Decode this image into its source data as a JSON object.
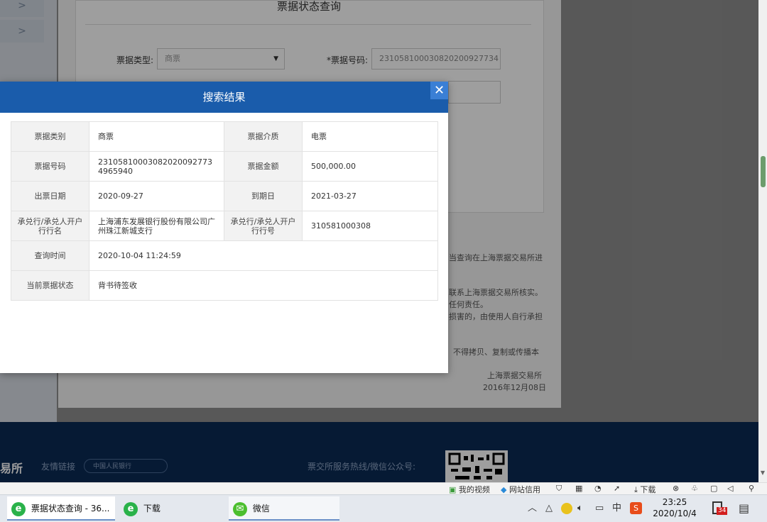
{
  "background": {
    "nav_arrows": [
      ">",
      ">"
    ],
    "page_title": "票据状态查询",
    "form": {
      "bill_type_label": "票据类型:",
      "bill_type_value": "商票",
      "bill_no_label": "*票据号码:",
      "bill_no_value": "231058100030820200927734"
    },
    "notice_lines": [
      "当查询在上海票据交易所进",
      "联系上海票据交易所核实。",
      "任何责任。",
      "损害的，由使用人自行承担",
      "不得拷贝、复制或传播本"
    ],
    "notice_sign": "上海票据交易所",
    "notice_date": "2016年12月08日",
    "footer": {
      "logo_text": "易所",
      "links_label": "友情链接",
      "links_select": "中国人民银行",
      "hotline_label": "票交所服务热线/微信公众号:"
    }
  },
  "dialog": {
    "title": "搜索结果",
    "close_glyph": "✕",
    "rows": [
      {
        "k1": "票据类别",
        "v1": "商票",
        "k2": "票据介质",
        "v2": "电票"
      },
      {
        "k1": "票据号码",
        "v1": "231058100030820200927734965940",
        "k2": "票据金额",
        "v2": "500,000.00"
      },
      {
        "k1": "出票日期",
        "v1": "2020-09-27",
        "k2": "到期日",
        "v2": "2021-03-27"
      },
      {
        "k1": "承兑行/承兑人开户行行名",
        "v1": "上海浦东发展银行股份有限公司广州珠江新城支行",
        "k2": "承兑行/承兑人开户行行号",
        "v2": "310581000308"
      }
    ],
    "row_query_time": {
      "k": "查询时间",
      "v": "2020-10-04 11:24:59"
    },
    "row_status": {
      "k": "当前票据状态",
      "v": "背书待签收"
    }
  },
  "statusbar": {
    "my_video": "我的视频",
    "site_credit": "网站信用",
    "download": "下载"
  },
  "taskbar": {
    "apps": [
      {
        "label": "票据状态查询 - 36...",
        "icon": "ie-icon"
      },
      {
        "label": "下载",
        "icon": "ie-icon"
      },
      {
        "label": "微信",
        "icon": "wechat-icon"
      }
    ],
    "tray_ime": "中",
    "clock_time": "23:25",
    "clock_date": "2020/10/4",
    "notif_count": "34"
  }
}
